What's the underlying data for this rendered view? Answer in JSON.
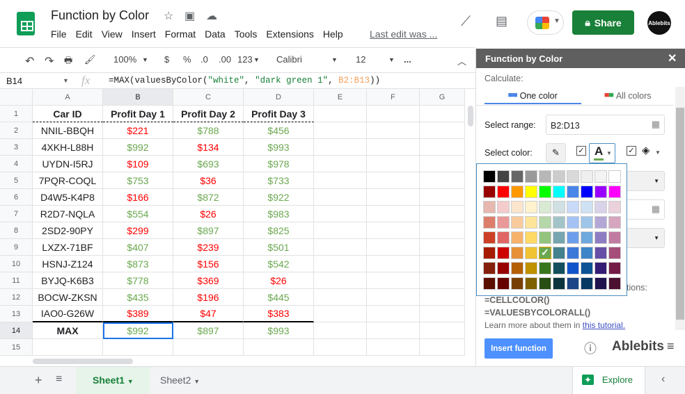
{
  "app": {
    "title": "Function by Color",
    "menu": [
      "File",
      "Edit",
      "View",
      "Insert",
      "Format",
      "Data",
      "Tools",
      "Extensions",
      "Help"
    ],
    "last_edit": "Last edit was ...",
    "share": "Share",
    "avatar": "Ablebits"
  },
  "toolbar": {
    "zoom": "100%",
    "currency": "$",
    "percent": "%",
    "dec_less": ".0",
    "dec_more": ".00",
    "format": "123",
    "font": "Calibri",
    "size": "12",
    "more": "..."
  },
  "formula_bar": {
    "cell_ref": "B14",
    "fx": "fx",
    "formula_prefix": "=MAX(valuesByColor(",
    "arg1": "\"white\"",
    "sep1": ", ",
    "arg2": "\"dark green 1\"",
    "sep2": ", ",
    "arg3": "B2:B13",
    "formula_suffix": "))"
  },
  "sheet": {
    "columns": [
      "A",
      "B",
      "C",
      "D",
      "E",
      "F",
      "G"
    ],
    "rows": [
      "1",
      "2",
      "3",
      "4",
      "5",
      "6",
      "7",
      "8",
      "9",
      "10",
      "11",
      "12",
      "13",
      "14",
      "15"
    ],
    "header": [
      "Car ID",
      "Profit Day 1",
      "Profit Day 2",
      "Profit Day 3"
    ],
    "data": [
      [
        [
          "NNIL-BBQH"
        ],
        [
          "$221",
          "r"
        ],
        [
          "$788",
          "g"
        ],
        [
          "$456",
          "g"
        ]
      ],
      [
        [
          "4XKH-L88H"
        ],
        [
          "$992",
          "g"
        ],
        [
          "$134",
          "r"
        ],
        [
          "$993",
          "g"
        ]
      ],
      [
        [
          "UYDN-I5RJ"
        ],
        [
          "$109",
          "r"
        ],
        [
          "$693",
          "g"
        ],
        [
          "$978",
          "g"
        ]
      ],
      [
        [
          "7PQR-COQL"
        ],
        [
          "$753",
          "g"
        ],
        [
          "$36",
          "r"
        ],
        [
          "$733",
          "g"
        ]
      ],
      [
        [
          "D4W5-K4P8"
        ],
        [
          "$166",
          "r"
        ],
        [
          "$872",
          "g"
        ],
        [
          "$922",
          "g"
        ]
      ],
      [
        [
          "R2D7-NQLA"
        ],
        [
          "$554",
          "g"
        ],
        [
          "$26",
          "r"
        ],
        [
          "$983",
          "g"
        ]
      ],
      [
        [
          "2SD2-90PY"
        ],
        [
          "$299",
          "r"
        ],
        [
          "$897",
          "g"
        ],
        [
          "$825",
          "g"
        ]
      ],
      [
        [
          "LXZX-71BF"
        ],
        [
          "$407",
          "g"
        ],
        [
          "$239",
          "r"
        ],
        [
          "$501",
          "g"
        ]
      ],
      [
        [
          "HSNJ-Z124"
        ],
        [
          "$873",
          "g"
        ],
        [
          "$156",
          "r"
        ],
        [
          "$542",
          "g"
        ]
      ],
      [
        [
          "BYJQ-K6B3"
        ],
        [
          "$778",
          "g"
        ],
        [
          "$369",
          "r"
        ],
        [
          "$26",
          "r"
        ]
      ],
      [
        [
          "BOCW-ZKSN"
        ],
        [
          "$435",
          "g"
        ],
        [
          "$196",
          "r"
        ],
        [
          "$445",
          "g"
        ]
      ],
      [
        [
          "IAO0-G26W"
        ],
        [
          "$389",
          "r"
        ],
        [
          "$47",
          "r"
        ],
        [
          "$383",
          "r"
        ]
      ]
    ],
    "max_row": [
      [
        "MAX"
      ],
      [
        "$992",
        "g"
      ],
      [
        "$897",
        "g"
      ],
      [
        "$993",
        "g"
      ]
    ],
    "selected_cell": "B14",
    "colors": {
      "g": "#6aa84f",
      "r": "#ff0000"
    }
  },
  "tabs": [
    {
      "label": "Sheet1",
      "active": true
    },
    {
      "label": "Sheet2",
      "active": false
    }
  ],
  "explore": "Explore",
  "panel": {
    "title": "Function by Color",
    "calculate": "Calculate:",
    "tab_one": "One color",
    "tab_all": "All colors",
    "range_label": "Select range:",
    "range_value": "B2:D13",
    "color_label": "Select color:",
    "font_color_checked": true,
    "fill_color_checked": true,
    "font_color": "#6aa84f",
    "partial_text": "tions:",
    "fn1": "=CELLCOLOR()",
    "fn2": "=VALUESBYCOLORALL()",
    "learn": "Learn more about them in ",
    "link": "this tutorial.",
    "insert": "Insert function",
    "brand": "Ablebits"
  },
  "palette": {
    "selected": "#6aa84f",
    "rows": [
      [
        "#000000",
        "#434343",
        "#666666",
        "#999999",
        "#b7b7b7",
        "#cccccc",
        "#d9d9d9",
        "#efefef",
        "#f3f3f3",
        "#ffffff"
      ],
      [
        "#980000",
        "#ff0000",
        "#ff9900",
        "#ffff00",
        "#00ff00",
        "#00ffff",
        "#4a86e8",
        "#0000ff",
        "#9900ff",
        "#ff00ff"
      ],
      [
        "#e6b8af",
        "#f4cccc",
        "#fce5cd",
        "#fff2cc",
        "#d9ead3",
        "#d0e0e3",
        "#c9daf8",
        "#cfe2f3",
        "#d9d2e9",
        "#ead1dc"
      ],
      [
        "#dd7e6b",
        "#ea9999",
        "#f9cb9c",
        "#ffe599",
        "#b6d7a8",
        "#a2c4c9",
        "#a4c2f4",
        "#9fc5e8",
        "#b4a7d6",
        "#d5a6bd"
      ],
      [
        "#cc4125",
        "#e06666",
        "#f6b26b",
        "#ffd966",
        "#93c47d",
        "#76a5af",
        "#6d9eeb",
        "#6fa8dc",
        "#8e7cc3",
        "#c27ba0"
      ],
      [
        "#a61c00",
        "#cc0000",
        "#e69138",
        "#f1c232",
        "#6aa84f",
        "#45818e",
        "#3c78d8",
        "#3d85c6",
        "#674ea7",
        "#a64d79"
      ],
      [
        "#85200c",
        "#990000",
        "#b45f06",
        "#bf9000",
        "#38761d",
        "#134f5c",
        "#1155cc",
        "#0b5394",
        "#351c75",
        "#741b47"
      ],
      [
        "#5b0f00",
        "#660000",
        "#783f04",
        "#7f6000",
        "#274e13",
        "#0c343d",
        "#1c4587",
        "#073763",
        "#20124d",
        "#4c1130"
      ]
    ]
  }
}
